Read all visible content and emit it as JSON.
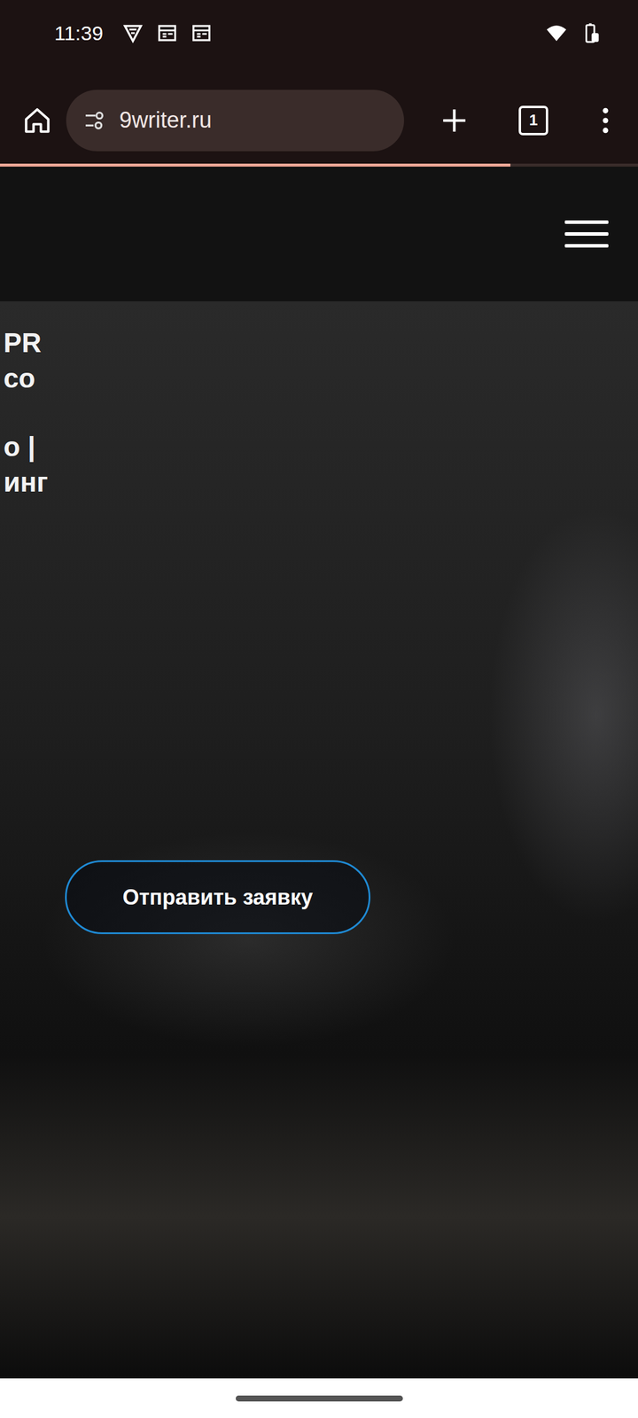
{
  "status_bar": {
    "time": "11:39"
  },
  "browser": {
    "url": "9writer.ru",
    "tab_count": "1",
    "load_level": 0.8
  },
  "hero": {
    "heading_groups": [
      [
        "PR",
        "со"
      ],
      [
        "о |",
        "инг"
      ]
    ],
    "button": "Отправить заявку"
  }
}
